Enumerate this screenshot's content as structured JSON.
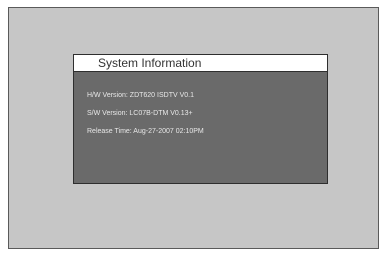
{
  "dialog": {
    "title": "System Information",
    "lines": [
      "H/W Version: ZDT620 ISDTV V0.1",
      "S/W Version: LC07B-DTM V0.13+",
      "Release Time: Aug-27-2007 02:10PM"
    ]
  }
}
